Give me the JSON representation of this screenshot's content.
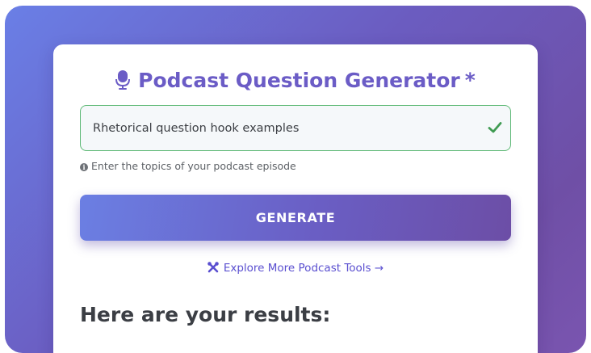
{
  "form": {
    "title": "Podcast Question Generator",
    "required_marker": "*",
    "title_icon": "microphone-icon",
    "input_value": "Rhetorical question hook examples",
    "input_valid_icon": "checkmark-icon",
    "hint_icon": "info-icon",
    "hint_text": "Enter the topics of your podcast episode",
    "generate_label": "GENERATE",
    "explore_icon": "tools-icon",
    "explore_label": "Explore More Podcast Tools →",
    "results_heading": "Here are your results:"
  },
  "colors": {
    "accent": "#6b5cc6",
    "valid_border": "#5cb874",
    "link": "#5a4fd0",
    "gradient_start": "#6a7fe6",
    "gradient_end": "#6f4fa6"
  }
}
